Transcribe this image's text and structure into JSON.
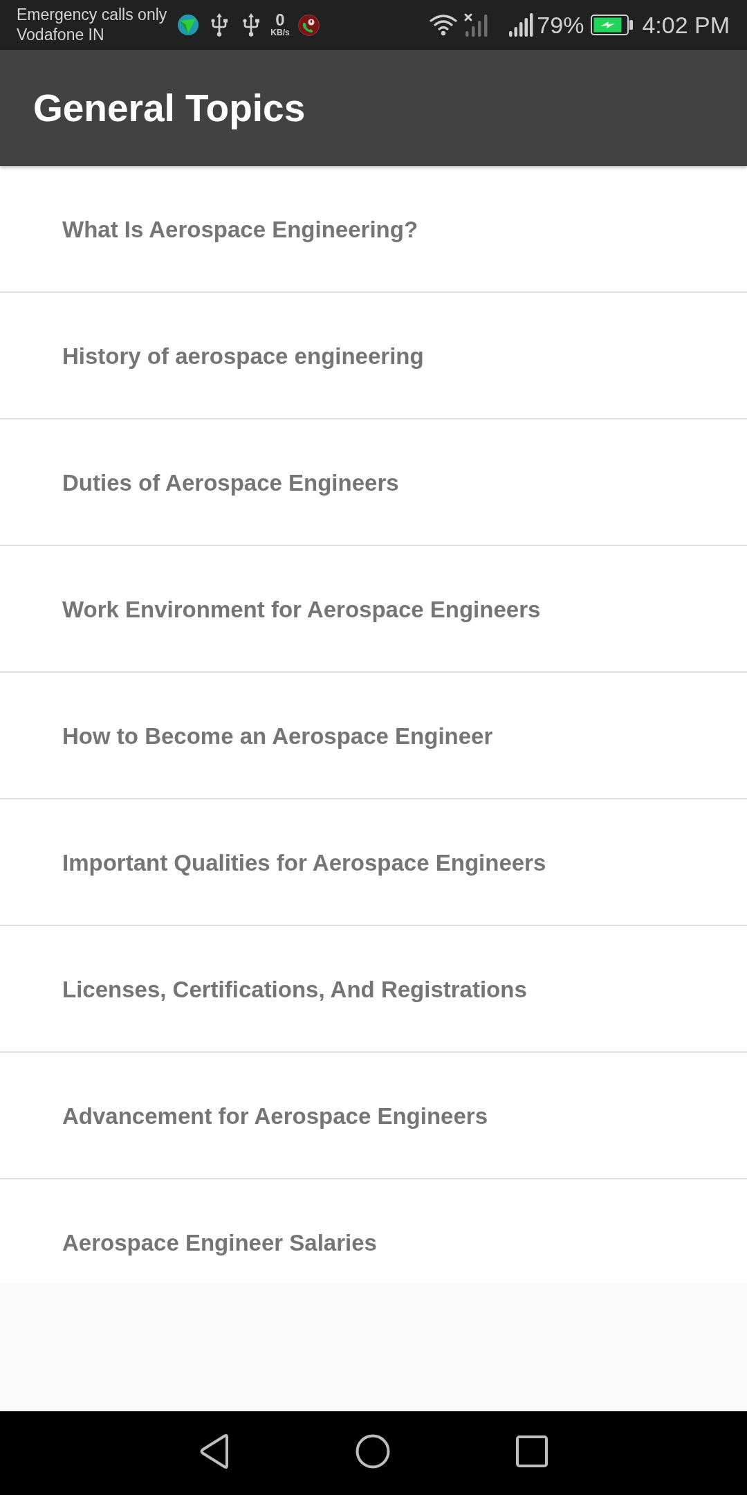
{
  "status_bar": {
    "network_status": "Emergency calls only",
    "carrier": "Vodafone IN",
    "speed_value": "0",
    "speed_unit": "KB/s",
    "battery_percent": "79%",
    "time": "4:02 PM"
  },
  "app_bar": {
    "title": "General Topics"
  },
  "topics": [
    "What Is Aerospace Engineering?",
    "History of aerospace engineering",
    "Duties of Aerospace Engineers",
    "Work Environment for Aerospace Engineers",
    "How to Become an Aerospace Engineer",
    "Important Qualities for Aerospace Engineers",
    "Licenses, Certifications, And Registrations",
    "Advancement for Aerospace Engineers",
    "Aerospace Engineer Salaries"
  ]
}
